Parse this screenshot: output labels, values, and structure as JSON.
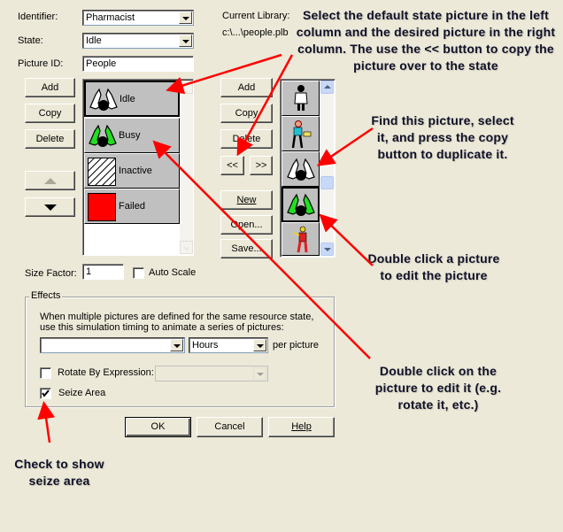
{
  "form": {
    "identifier_label": "Identifier:",
    "identifier_value": "Pharmacist",
    "state_label": "State:",
    "state_value": "Idle",
    "picture_id_label": "Picture ID:",
    "picture_id_value": "People",
    "current_library_label": "Current Library:",
    "current_library_path": "c:\\...\\people.plb"
  },
  "left_buttons": {
    "add": "Add",
    "copy": "Copy",
    "delete": "Delete",
    "up_icon": "up-arrow-icon",
    "down_icon": "down-arrow-icon"
  },
  "state_pictures": [
    {
      "name": "Idle",
      "icon": "idle-person-white-icon",
      "selected": true
    },
    {
      "name": "Busy",
      "icon": "busy-person-green-icon",
      "selected": false
    },
    {
      "name": "Inactive",
      "icon": "hatched-square-icon",
      "selected": false
    },
    {
      "name": "Failed",
      "icon": "red-square-icon",
      "selected": false
    }
  ],
  "library_buttons": {
    "add": "Add",
    "copy": "Copy",
    "delete": "Delete",
    "copy_left": "<<",
    "copy_right": ">>",
    "new": "New",
    "open": "Open...",
    "save": "Save..."
  },
  "library_pictures": [
    {
      "icon": "doctor-icon"
    },
    {
      "icon": "worker-carrying-box-icon"
    },
    {
      "icon": "idle-person-white-icon"
    },
    {
      "icon": "busy-person-green-icon",
      "selected": true
    },
    {
      "icon": "red-worker-icon"
    }
  ],
  "size": {
    "label": "Size Factor:",
    "value": "1",
    "auto_scale_label": "Auto Scale",
    "auto_scale_checked": false
  },
  "effects": {
    "title": "Effects",
    "description": "When multiple pictures are defined for the same resource state, use this simulation timing to animate a series of pictures:",
    "timing_value": "",
    "units_value": "Hours",
    "per_picture_label": "per picture",
    "rotate_label": "Rotate By Expression:",
    "rotate_checked": false,
    "rotate_value": "",
    "seize_label": "Seize Area",
    "seize_checked": true
  },
  "dialog_buttons": {
    "ok": "OK",
    "cancel": "Cancel",
    "help": "Help"
  },
  "annotations": {
    "top": "Select the default state picture in the left column and the desired picture in the right column. The use the << button to copy the picture over to the state",
    "find": "Find this picture, select it, and press the copy button to duplicate it.",
    "double_click_library": "Double click a picture to edit the picture",
    "double_click_state": "Double click on the picture to edit it (e.g. rotate it, etc.)",
    "seize": "Check to show seize area"
  },
  "colors": {
    "dialog_bg": "#ece9d8",
    "arrow": "#ff0000",
    "busy_green": "#22dd22",
    "failed_red": "#ff0000"
  }
}
